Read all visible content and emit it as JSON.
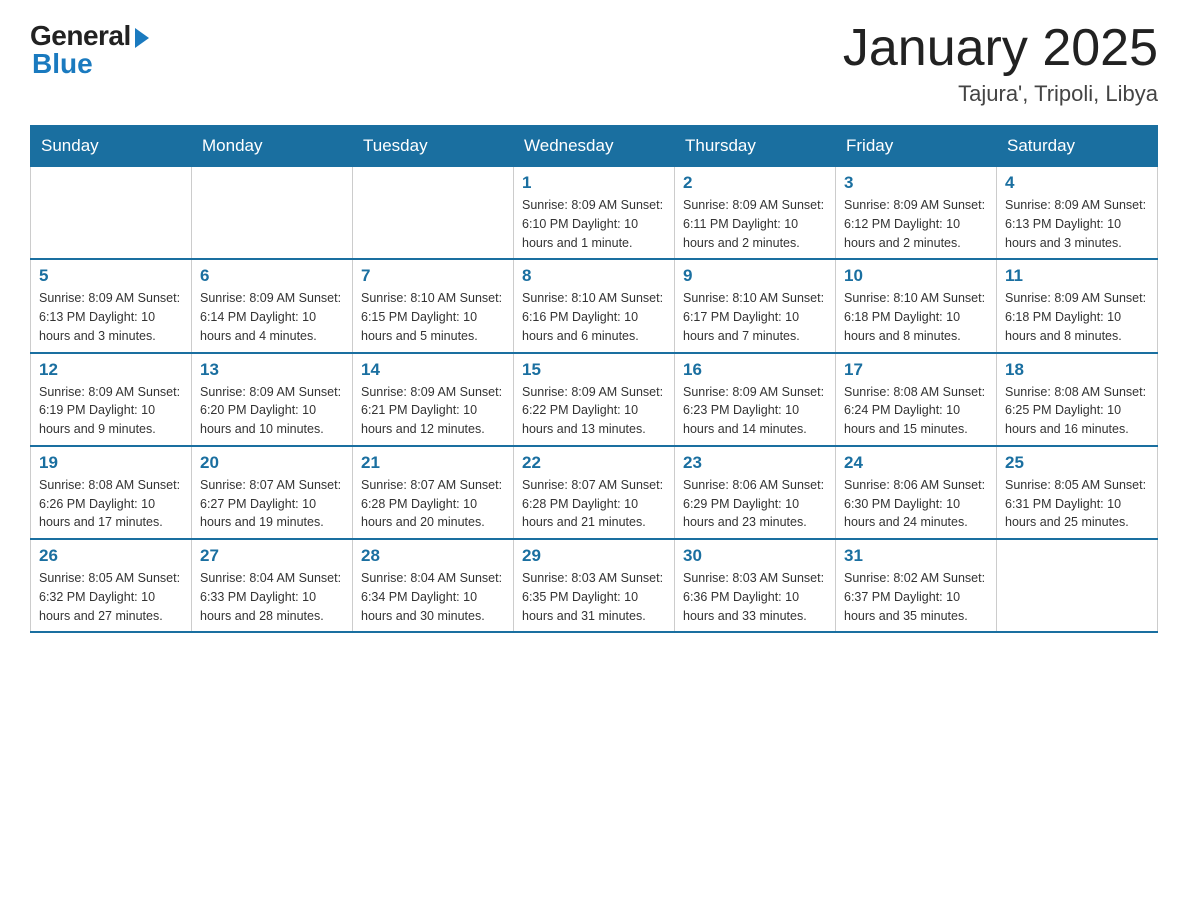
{
  "header": {
    "logo_general": "General",
    "logo_blue": "Blue",
    "month_title": "January 2025",
    "location": "Tajura', Tripoli, Libya"
  },
  "days_of_week": [
    "Sunday",
    "Monday",
    "Tuesday",
    "Wednesday",
    "Thursday",
    "Friday",
    "Saturday"
  ],
  "weeks": [
    [
      {
        "day": "",
        "info": ""
      },
      {
        "day": "",
        "info": ""
      },
      {
        "day": "",
        "info": ""
      },
      {
        "day": "1",
        "info": "Sunrise: 8:09 AM\nSunset: 6:10 PM\nDaylight: 10 hours and 1 minute."
      },
      {
        "day": "2",
        "info": "Sunrise: 8:09 AM\nSunset: 6:11 PM\nDaylight: 10 hours and 2 minutes."
      },
      {
        "day": "3",
        "info": "Sunrise: 8:09 AM\nSunset: 6:12 PM\nDaylight: 10 hours and 2 minutes."
      },
      {
        "day": "4",
        "info": "Sunrise: 8:09 AM\nSunset: 6:13 PM\nDaylight: 10 hours and 3 minutes."
      }
    ],
    [
      {
        "day": "5",
        "info": "Sunrise: 8:09 AM\nSunset: 6:13 PM\nDaylight: 10 hours and 3 minutes."
      },
      {
        "day": "6",
        "info": "Sunrise: 8:09 AM\nSunset: 6:14 PM\nDaylight: 10 hours and 4 minutes."
      },
      {
        "day": "7",
        "info": "Sunrise: 8:10 AM\nSunset: 6:15 PM\nDaylight: 10 hours and 5 minutes."
      },
      {
        "day": "8",
        "info": "Sunrise: 8:10 AM\nSunset: 6:16 PM\nDaylight: 10 hours and 6 minutes."
      },
      {
        "day": "9",
        "info": "Sunrise: 8:10 AM\nSunset: 6:17 PM\nDaylight: 10 hours and 7 minutes."
      },
      {
        "day": "10",
        "info": "Sunrise: 8:10 AM\nSunset: 6:18 PM\nDaylight: 10 hours and 8 minutes."
      },
      {
        "day": "11",
        "info": "Sunrise: 8:09 AM\nSunset: 6:18 PM\nDaylight: 10 hours and 8 minutes."
      }
    ],
    [
      {
        "day": "12",
        "info": "Sunrise: 8:09 AM\nSunset: 6:19 PM\nDaylight: 10 hours and 9 minutes."
      },
      {
        "day": "13",
        "info": "Sunrise: 8:09 AM\nSunset: 6:20 PM\nDaylight: 10 hours and 10 minutes."
      },
      {
        "day": "14",
        "info": "Sunrise: 8:09 AM\nSunset: 6:21 PM\nDaylight: 10 hours and 12 minutes."
      },
      {
        "day": "15",
        "info": "Sunrise: 8:09 AM\nSunset: 6:22 PM\nDaylight: 10 hours and 13 minutes."
      },
      {
        "day": "16",
        "info": "Sunrise: 8:09 AM\nSunset: 6:23 PM\nDaylight: 10 hours and 14 minutes."
      },
      {
        "day": "17",
        "info": "Sunrise: 8:08 AM\nSunset: 6:24 PM\nDaylight: 10 hours and 15 minutes."
      },
      {
        "day": "18",
        "info": "Sunrise: 8:08 AM\nSunset: 6:25 PM\nDaylight: 10 hours and 16 minutes."
      }
    ],
    [
      {
        "day": "19",
        "info": "Sunrise: 8:08 AM\nSunset: 6:26 PM\nDaylight: 10 hours and 17 minutes."
      },
      {
        "day": "20",
        "info": "Sunrise: 8:07 AM\nSunset: 6:27 PM\nDaylight: 10 hours and 19 minutes."
      },
      {
        "day": "21",
        "info": "Sunrise: 8:07 AM\nSunset: 6:28 PM\nDaylight: 10 hours and 20 minutes."
      },
      {
        "day": "22",
        "info": "Sunrise: 8:07 AM\nSunset: 6:28 PM\nDaylight: 10 hours and 21 minutes."
      },
      {
        "day": "23",
        "info": "Sunrise: 8:06 AM\nSunset: 6:29 PM\nDaylight: 10 hours and 23 minutes."
      },
      {
        "day": "24",
        "info": "Sunrise: 8:06 AM\nSunset: 6:30 PM\nDaylight: 10 hours and 24 minutes."
      },
      {
        "day": "25",
        "info": "Sunrise: 8:05 AM\nSunset: 6:31 PM\nDaylight: 10 hours and 25 minutes."
      }
    ],
    [
      {
        "day": "26",
        "info": "Sunrise: 8:05 AM\nSunset: 6:32 PM\nDaylight: 10 hours and 27 minutes."
      },
      {
        "day": "27",
        "info": "Sunrise: 8:04 AM\nSunset: 6:33 PM\nDaylight: 10 hours and 28 minutes."
      },
      {
        "day": "28",
        "info": "Sunrise: 8:04 AM\nSunset: 6:34 PM\nDaylight: 10 hours and 30 minutes."
      },
      {
        "day": "29",
        "info": "Sunrise: 8:03 AM\nSunset: 6:35 PM\nDaylight: 10 hours and 31 minutes."
      },
      {
        "day": "30",
        "info": "Sunrise: 8:03 AM\nSunset: 6:36 PM\nDaylight: 10 hours and 33 minutes."
      },
      {
        "day": "31",
        "info": "Sunrise: 8:02 AM\nSunset: 6:37 PM\nDaylight: 10 hours and 35 minutes."
      },
      {
        "day": "",
        "info": ""
      }
    ]
  ]
}
